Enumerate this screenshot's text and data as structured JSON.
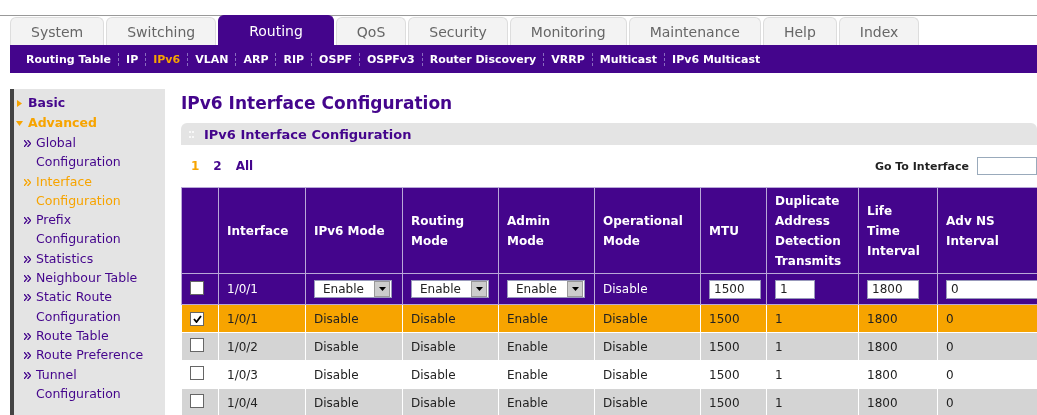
{
  "main_tabs": [
    {
      "label": "System",
      "selected": false
    },
    {
      "label": "Switching",
      "selected": false
    },
    {
      "label": "Routing",
      "selected": true
    },
    {
      "label": "QoS",
      "selected": false
    },
    {
      "label": "Security",
      "selected": false
    },
    {
      "label": "Monitoring",
      "selected": false
    },
    {
      "label": "Maintenance",
      "selected": false
    },
    {
      "label": "Help",
      "selected": false
    },
    {
      "label": "Index",
      "selected": false
    }
  ],
  "sub_tabs": [
    {
      "label": "Routing Table",
      "selected": false
    },
    {
      "label": "IP",
      "selected": false
    },
    {
      "label": "IPv6",
      "selected": true
    },
    {
      "label": "VLAN",
      "selected": false
    },
    {
      "label": "ARP",
      "selected": false
    },
    {
      "label": "RIP",
      "selected": false
    },
    {
      "label": "OSPF",
      "selected": false
    },
    {
      "label": "OSPFv3",
      "selected": false
    },
    {
      "label": "Router Discovery",
      "selected": false
    },
    {
      "label": "VRRP",
      "selected": false
    },
    {
      "label": "Multicast",
      "selected": false
    },
    {
      "label": "IPv6 Multicast",
      "selected": false
    }
  ],
  "sidebar": {
    "items": [
      {
        "label": "Basic",
        "expanded": false
      },
      {
        "label": "Advanced",
        "expanded": true,
        "children": [
          {
            "label": "Global Configuration",
            "selected": false
          },
          {
            "label": "Interface Configuration",
            "selected": true
          },
          {
            "label": "Prefix Configuration",
            "selected": false
          },
          {
            "label": "Statistics",
            "selected": false
          },
          {
            "label": "Neighbour Table",
            "selected": false
          },
          {
            "label": "Static Route Configuration",
            "selected": false
          },
          {
            "label": "Route Table",
            "selected": false
          },
          {
            "label": "Route Preference",
            "selected": false
          },
          {
            "label": "Tunnel Configuration",
            "selected": false
          }
        ]
      }
    ]
  },
  "page_title": "IPv6 Interface Configuration",
  "panel": {
    "title": "IPv6 Interface Configuration",
    "pages": [
      {
        "label": "1",
        "selected": true
      },
      {
        "label": "2",
        "selected": false
      },
      {
        "label": "All",
        "selected": false
      }
    ],
    "goto_label": "Go To Interface",
    "table": {
      "columns": [
        "Interface",
        "IPv6 Mode",
        "Routing Mode",
        "Admin Mode",
        "Operational Mode",
        "MTU",
        "Duplicate Address Detection Transmits",
        "Life Time Interval",
        "Adv NS Interval"
      ],
      "edit_row": {
        "checked": false,
        "interface": "1/0/1",
        "ipv6_mode": "Enable",
        "routing_mode": "Enable",
        "admin_mode": "Enable",
        "operational_mode": "Disable",
        "mtu": "1500",
        "dad_transmits": "1",
        "life_time": "1800",
        "adv_ns": "0"
      },
      "rows": [
        {
          "checked": true,
          "selected": true,
          "cells": [
            "1/0/1",
            "Disable",
            "Disable",
            "Enable",
            "Disable",
            "1500",
            "1",
            "1800",
            "0"
          ]
        },
        {
          "checked": false,
          "selected": false,
          "cells": [
            "1/0/2",
            "Disable",
            "Disable",
            "Enable",
            "Disable",
            "1500",
            "1",
            "1800",
            "0"
          ]
        },
        {
          "checked": false,
          "selected": false,
          "cells": [
            "1/0/3",
            "Disable",
            "Disable",
            "Enable",
            "Disable",
            "1500",
            "1",
            "1800",
            "0"
          ]
        },
        {
          "checked": false,
          "selected": false,
          "cells": [
            "1/0/4",
            "Disable",
            "Disable",
            "Enable",
            "Disable",
            "1500",
            "1",
            "1800",
            "0"
          ]
        }
      ]
    }
  }
}
